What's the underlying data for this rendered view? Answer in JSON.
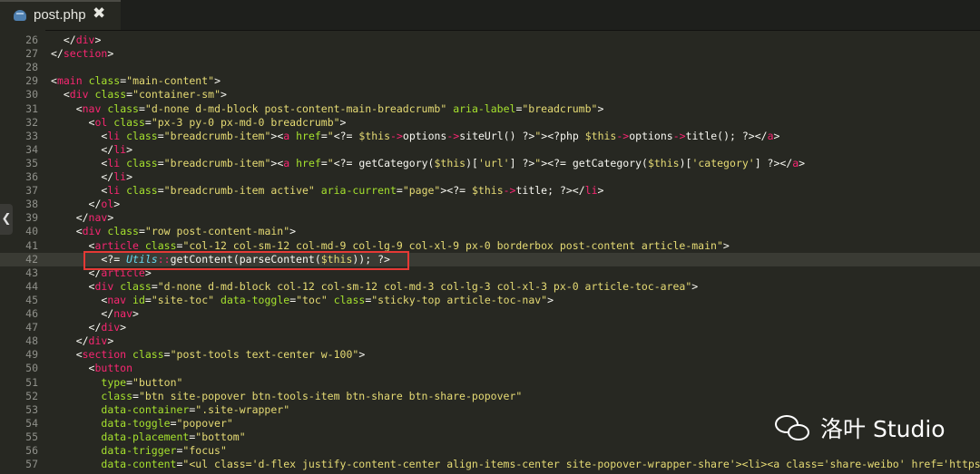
{
  "tab": {
    "filename": "post.php",
    "close_glyph": "✖"
  },
  "side_handle": {
    "glyph": "❮"
  },
  "highlight_color": "#e53935",
  "watermark": {
    "text": "洛叶 Studio",
    "icon": "wechat-icon"
  },
  "lines": [
    {
      "n": "26",
      "tokens": [
        [
          "pl",
          "  </"
        ],
        [
          "tag",
          "div"
        ],
        [
          "pl",
          ">"
        ]
      ]
    },
    {
      "n": "27",
      "tokens": [
        [
          "pl",
          "</"
        ],
        [
          "tag",
          "section"
        ],
        [
          "pl",
          ">"
        ]
      ]
    },
    {
      "n": "28",
      "tokens": []
    },
    {
      "n": "29",
      "tokens": [
        [
          "pl",
          "<"
        ],
        [
          "tag",
          "main"
        ],
        [
          "pl",
          " "
        ],
        [
          "attr",
          "class"
        ],
        [
          "pl",
          "="
        ],
        [
          "str",
          "\"main-content\""
        ],
        [
          "pl",
          ">"
        ]
      ]
    },
    {
      "n": "30",
      "tokens": [
        [
          "pl",
          "  <"
        ],
        [
          "tag",
          "div"
        ],
        [
          "pl",
          " "
        ],
        [
          "attr",
          "class"
        ],
        [
          "pl",
          "="
        ],
        [
          "str",
          "\"container-sm\""
        ],
        [
          "pl",
          ">"
        ]
      ]
    },
    {
      "n": "31",
      "tokens": [
        [
          "pl",
          "    <"
        ],
        [
          "tag",
          "nav"
        ],
        [
          "pl",
          " "
        ],
        [
          "attr",
          "class"
        ],
        [
          "pl",
          "="
        ],
        [
          "str",
          "\"d-none d-md-block post-content-main-breadcrumb\""
        ],
        [
          "pl",
          " "
        ],
        [
          "attr",
          "aria-label"
        ],
        [
          "pl",
          "="
        ],
        [
          "str",
          "\"breadcrumb\""
        ],
        [
          "pl",
          ">"
        ]
      ]
    },
    {
      "n": "32",
      "tokens": [
        [
          "pl",
          "      <"
        ],
        [
          "tag",
          "ol"
        ],
        [
          "pl",
          " "
        ],
        [
          "attr",
          "class"
        ],
        [
          "pl",
          "="
        ],
        [
          "str",
          "\"px-3 py-0 px-md-0 breadcrumb\""
        ],
        [
          "pl",
          ">"
        ]
      ]
    },
    {
      "n": "33",
      "tokens": [
        [
          "pl",
          "        <"
        ],
        [
          "tag",
          "li"
        ],
        [
          "pl",
          " "
        ],
        [
          "attr",
          "class"
        ],
        [
          "pl",
          "="
        ],
        [
          "str",
          "\"breadcrumb-item\""
        ],
        [
          "pl",
          ">"
        ],
        [
          "pl",
          "<"
        ],
        [
          "tag",
          "a"
        ],
        [
          "pl",
          " "
        ],
        [
          "attr",
          "href"
        ],
        [
          "pl",
          "="
        ],
        [
          "str",
          "\""
        ],
        [
          "pl",
          "<?= "
        ],
        [
          "var",
          "$this"
        ],
        [
          "op",
          "->"
        ],
        [
          "pl",
          "options"
        ],
        [
          "op",
          "->"
        ],
        [
          "pl",
          "siteUrl() ?>"
        ],
        [
          "str",
          "\""
        ],
        [
          "pl",
          ">"
        ],
        [
          "pl",
          "<?php "
        ],
        [
          "var",
          "$this"
        ],
        [
          "op",
          "->"
        ],
        [
          "pl",
          "options"
        ],
        [
          "op",
          "->"
        ],
        [
          "pl",
          "title(); ?></"
        ],
        [
          "tag",
          "a"
        ],
        [
          "pl",
          ">"
        ]
      ]
    },
    {
      "n": "34",
      "tokens": [
        [
          "pl",
          "        </"
        ],
        [
          "tag",
          "li"
        ],
        [
          "pl",
          ">"
        ]
      ]
    },
    {
      "n": "35",
      "tokens": [
        [
          "pl",
          "        <"
        ],
        [
          "tag",
          "li"
        ],
        [
          "pl",
          " "
        ],
        [
          "attr",
          "class"
        ],
        [
          "pl",
          "="
        ],
        [
          "str",
          "\"breadcrumb-item\""
        ],
        [
          "pl",
          ">"
        ],
        [
          "pl",
          "<"
        ],
        [
          "tag",
          "a"
        ],
        [
          "pl",
          " "
        ],
        [
          "attr",
          "href"
        ],
        [
          "pl",
          "="
        ],
        [
          "str",
          "\""
        ],
        [
          "pl",
          "<?= getCategory("
        ],
        [
          "var",
          "$this"
        ],
        [
          "pl",
          ")["
        ],
        [
          "str",
          "'url'"
        ],
        [
          "pl",
          "] ?>"
        ],
        [
          "str",
          "\""
        ],
        [
          "pl",
          ">"
        ],
        [
          "pl",
          "<?= getCategory("
        ],
        [
          "var",
          "$this"
        ],
        [
          "pl",
          ")["
        ],
        [
          "str",
          "'category'"
        ],
        [
          "pl",
          "] ?></"
        ],
        [
          "tag",
          "a"
        ],
        [
          "pl",
          ">"
        ]
      ]
    },
    {
      "n": "36",
      "tokens": [
        [
          "pl",
          "        </"
        ],
        [
          "tag",
          "li"
        ],
        [
          "pl",
          ">"
        ]
      ]
    },
    {
      "n": "37",
      "tokens": [
        [
          "pl",
          "        <"
        ],
        [
          "tag",
          "li"
        ],
        [
          "pl",
          " "
        ],
        [
          "attr",
          "class"
        ],
        [
          "pl",
          "="
        ],
        [
          "str",
          "\"breadcrumb-item active\""
        ],
        [
          "pl",
          " "
        ],
        [
          "attr",
          "aria-current"
        ],
        [
          "pl",
          "="
        ],
        [
          "str",
          "\"page\""
        ],
        [
          "pl",
          ">"
        ],
        [
          "pl",
          "<?= "
        ],
        [
          "var",
          "$this"
        ],
        [
          "op",
          "->"
        ],
        [
          "pl",
          "title; ?></"
        ],
        [
          "tag",
          "li"
        ],
        [
          "pl",
          ">"
        ]
      ]
    },
    {
      "n": "38",
      "tokens": [
        [
          "pl",
          "      </"
        ],
        [
          "tag",
          "ol"
        ],
        [
          "pl",
          ">"
        ]
      ]
    },
    {
      "n": "39",
      "tokens": [
        [
          "pl",
          "    </"
        ],
        [
          "tag",
          "nav"
        ],
        [
          "pl",
          ">"
        ]
      ]
    },
    {
      "n": "40",
      "tokens": [
        [
          "pl",
          "    <"
        ],
        [
          "tag",
          "div"
        ],
        [
          "pl",
          " "
        ],
        [
          "attr",
          "class"
        ],
        [
          "pl",
          "="
        ],
        [
          "str",
          "\"row post-content-main\""
        ],
        [
          "pl",
          ">"
        ]
      ]
    },
    {
      "n": "41",
      "tokens": [
        [
          "pl",
          "      <"
        ],
        [
          "tag",
          "article"
        ],
        [
          "pl",
          " "
        ],
        [
          "attr",
          "class"
        ],
        [
          "pl",
          "="
        ],
        [
          "str",
          "\"col-12 col-sm-12 col-md-9 col-lg-9 col-xl-9 px-0 borderbox post-content article-main\""
        ],
        [
          "pl",
          ">"
        ]
      ]
    },
    {
      "n": "42",
      "current": true,
      "tokens": [
        [
          "pl",
          "        <?= "
        ],
        [
          "kw",
          "Utils"
        ],
        [
          "op",
          "::"
        ],
        [
          "pl",
          "getContent(parseContent("
        ],
        [
          "var",
          "$this"
        ],
        [
          "pl",
          ")); ?>"
        ]
      ]
    },
    {
      "n": "43",
      "tokens": [
        [
          "pl",
          "      </"
        ],
        [
          "tag",
          "article"
        ],
        [
          "pl",
          ">"
        ]
      ]
    },
    {
      "n": "44",
      "tokens": [
        [
          "pl",
          "      <"
        ],
        [
          "tag",
          "div"
        ],
        [
          "pl",
          " "
        ],
        [
          "attr",
          "class"
        ],
        [
          "pl",
          "="
        ],
        [
          "str",
          "\"d-none d-md-block col-12 col-sm-12 col-md-3 col-lg-3 col-xl-3 px-0 article-toc-area\""
        ],
        [
          "pl",
          ">"
        ]
      ]
    },
    {
      "n": "45",
      "tokens": [
        [
          "pl",
          "        <"
        ],
        [
          "tag",
          "nav"
        ],
        [
          "pl",
          " "
        ],
        [
          "attr",
          "id"
        ],
        [
          "pl",
          "="
        ],
        [
          "str",
          "\"site-toc\""
        ],
        [
          "pl",
          " "
        ],
        [
          "attr",
          "data-toggle"
        ],
        [
          "pl",
          "="
        ],
        [
          "str",
          "\"toc\""
        ],
        [
          "pl",
          " "
        ],
        [
          "attr",
          "class"
        ],
        [
          "pl",
          "="
        ],
        [
          "str",
          "\"sticky-top article-toc-nav\""
        ],
        [
          "pl",
          ">"
        ]
      ]
    },
    {
      "n": "46",
      "tokens": [
        [
          "pl",
          "        </"
        ],
        [
          "tag",
          "nav"
        ],
        [
          "pl",
          ">"
        ]
      ]
    },
    {
      "n": "47",
      "tokens": [
        [
          "pl",
          "      </"
        ],
        [
          "tag",
          "div"
        ],
        [
          "pl",
          ">"
        ]
      ]
    },
    {
      "n": "48",
      "tokens": [
        [
          "pl",
          "    </"
        ],
        [
          "tag",
          "div"
        ],
        [
          "pl",
          ">"
        ]
      ]
    },
    {
      "n": "49",
      "tokens": [
        [
          "pl",
          "    <"
        ],
        [
          "tag",
          "section"
        ],
        [
          "pl",
          " "
        ],
        [
          "attr",
          "class"
        ],
        [
          "pl",
          "="
        ],
        [
          "str",
          "\"post-tools text-center w-100\""
        ],
        [
          "pl",
          ">"
        ]
      ]
    },
    {
      "n": "50",
      "tokens": [
        [
          "pl",
          "      <"
        ],
        [
          "tag",
          "button"
        ]
      ]
    },
    {
      "n": "51",
      "tokens": [
        [
          "pl",
          "        "
        ],
        [
          "attr",
          "type"
        ],
        [
          "pl",
          "="
        ],
        [
          "str",
          "\"button\""
        ]
      ]
    },
    {
      "n": "52",
      "tokens": [
        [
          "pl",
          "        "
        ],
        [
          "attr",
          "class"
        ],
        [
          "pl",
          "="
        ],
        [
          "str",
          "\"btn site-popover btn-tools-item btn-share btn-share-popover\""
        ]
      ]
    },
    {
      "n": "53",
      "tokens": [
        [
          "pl",
          "        "
        ],
        [
          "attr",
          "data-container"
        ],
        [
          "pl",
          "="
        ],
        [
          "str",
          "\".site-wrapper\""
        ]
      ]
    },
    {
      "n": "54",
      "tokens": [
        [
          "pl",
          "        "
        ],
        [
          "attr",
          "data-toggle"
        ],
        [
          "pl",
          "="
        ],
        [
          "str",
          "\"popover\""
        ]
      ]
    },
    {
      "n": "55",
      "tokens": [
        [
          "pl",
          "        "
        ],
        [
          "attr",
          "data-placement"
        ],
        [
          "pl",
          "="
        ],
        [
          "str",
          "\"bottom\""
        ]
      ]
    },
    {
      "n": "56",
      "tokens": [
        [
          "pl",
          "        "
        ],
        [
          "attr",
          "data-trigger"
        ],
        [
          "pl",
          "="
        ],
        [
          "str",
          "\"focus\""
        ]
      ]
    },
    {
      "n": "57",
      "tokens": [
        [
          "pl",
          "        "
        ],
        [
          "attr",
          "data-content"
        ],
        [
          "pl",
          "="
        ],
        [
          "str",
          "\"<ul class='d-flex justify-content-center align-items-center site-popover-wrapper-share'><li><a class='share-weibo' href='https"
        ]
      ]
    }
  ]
}
